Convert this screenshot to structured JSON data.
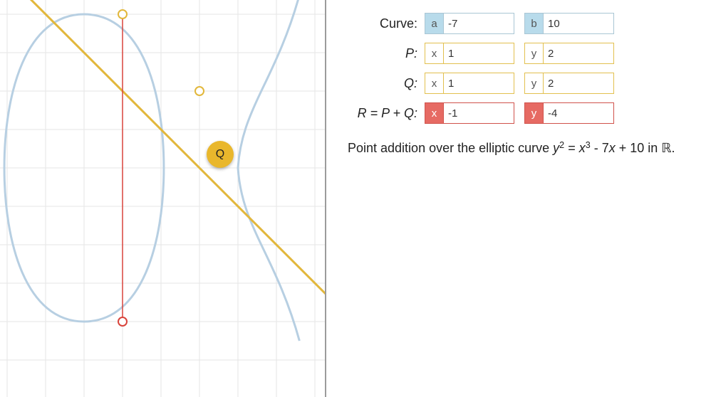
{
  "curve": {
    "label_a": "a",
    "a": "-7",
    "label_b": "b",
    "b": "10"
  },
  "p": {
    "label": "P:",
    "lx": "x",
    "x": "1",
    "ly": "y",
    "y": "2"
  },
  "q": {
    "label": "Q:",
    "lx": "x",
    "x": "1",
    "ly": "y",
    "y": "2",
    "marker": "Q"
  },
  "r": {
    "label": "R = P + Q:",
    "lx": "x",
    "x": "-1",
    "ly": "y",
    "y": "-4"
  },
  "labels": {
    "curve": "Curve:"
  },
  "caption": {
    "pre": "Point addition over the elliptic curve ",
    "eq_y": "y",
    "sq": "2",
    "eq_mid": " = ",
    "eq_x": "x",
    "cu": "3",
    "rest": " - 7",
    "xv": "x",
    "rest2": " + 10 in ",
    "real": "ℝ",
    "dot": "."
  },
  "chart_data": {
    "type": "line",
    "title": "Elliptic curve y^2 = x^3 - 7x + 10 over R with point doubling",
    "equation": "y^2 = x^3 - 7x + 10",
    "a": -7,
    "b": 10,
    "points": {
      "P": [
        1,
        2
      ],
      "Q": [
        1,
        2
      ],
      "R": [
        -1,
        -4
      ],
      "minusR": [
        -1,
        4
      ]
    },
    "tangent_line": {
      "slope": -1,
      "intercept": 3,
      "through": [
        1,
        2
      ]
    },
    "xlim_visible": [
      -4.2,
      4.3
    ],
    "ylim_visible": [
      -6,
      4.4
    ],
    "grid": true
  }
}
